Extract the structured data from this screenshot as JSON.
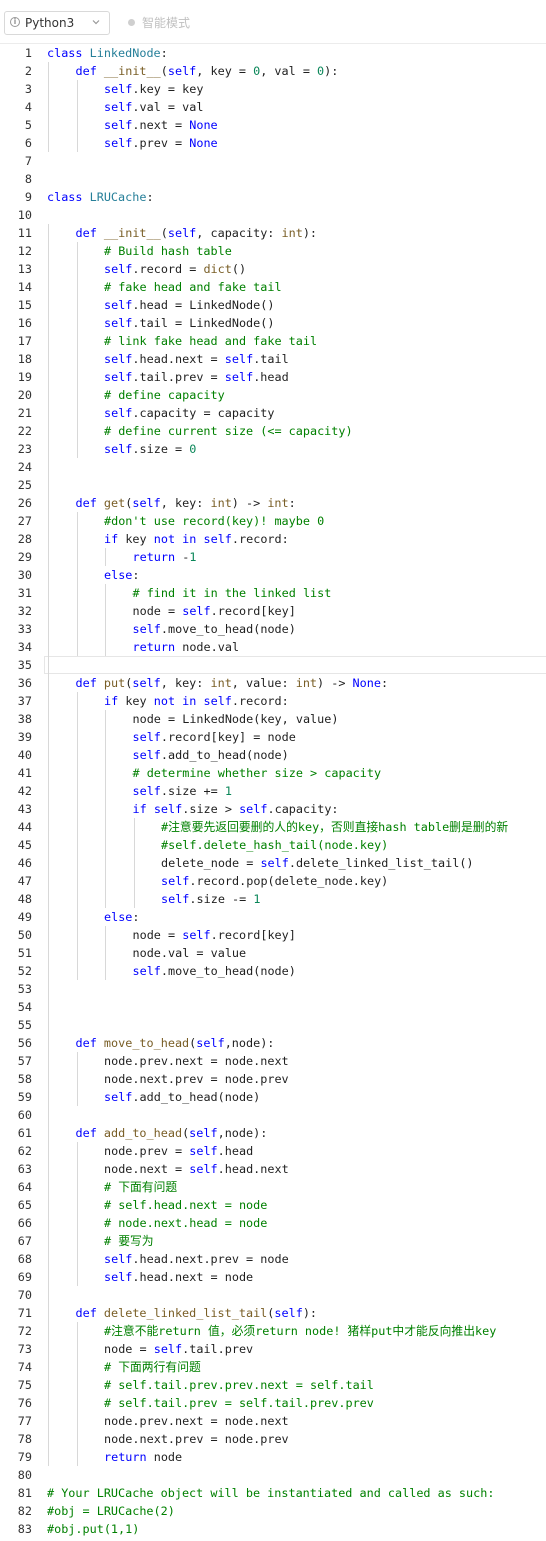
{
  "toolbar": {
    "language": "Python3",
    "language_icon": "info-icon",
    "dropdown_icon": "chevron-down-icon",
    "mode_label": "智能模式"
  },
  "editor": {
    "active_line": 35,
    "lines": [
      {
        "n": "1",
        "i": 0,
        "t": "class LinkedNode:"
      },
      {
        "n": "2",
        "i": 1,
        "t": "def __init__(self, key = 0, val = 0):"
      },
      {
        "n": "3",
        "i": 2,
        "t": "self.key = key"
      },
      {
        "n": "4",
        "i": 2,
        "t": "self.val = val"
      },
      {
        "n": "5",
        "i": 2,
        "t": "self.next = None"
      },
      {
        "n": "6",
        "i": 2,
        "t": "self.prev = None"
      },
      {
        "n": "7",
        "i": 0,
        "t": ""
      },
      {
        "n": "8",
        "i": 0,
        "t": ""
      },
      {
        "n": "9",
        "i": 0,
        "t": "class LRUCache:"
      },
      {
        "n": "10",
        "i": 0,
        "t": ""
      },
      {
        "n": "11",
        "i": 1,
        "t": "def __init__(self, capacity: int):"
      },
      {
        "n": "12",
        "i": 2,
        "t": "# Build hash table"
      },
      {
        "n": "13",
        "i": 2,
        "t": "self.record = dict()"
      },
      {
        "n": "14",
        "i": 2,
        "t": "# fake head and fake tail"
      },
      {
        "n": "15",
        "i": 2,
        "t": "self.head = LinkedNode()"
      },
      {
        "n": "16",
        "i": 2,
        "t": "self.tail = LinkedNode()"
      },
      {
        "n": "17",
        "i": 2,
        "t": "# link fake head and fake tail"
      },
      {
        "n": "18",
        "i": 2,
        "t": "self.head.next = self.tail"
      },
      {
        "n": "19",
        "i": 2,
        "t": "self.tail.prev = self.head"
      },
      {
        "n": "20",
        "i": 2,
        "t": "# define capacity"
      },
      {
        "n": "21",
        "i": 2,
        "t": "self.capacity = capacity"
      },
      {
        "n": "22",
        "i": 2,
        "t": "# define current size (<= capacity)"
      },
      {
        "n": "23",
        "i": 2,
        "t": "self.size = 0"
      },
      {
        "n": "24",
        "i": 0,
        "t": ""
      },
      {
        "n": "25",
        "i": 0,
        "t": ""
      },
      {
        "n": "26",
        "i": 1,
        "t": "def get(self, key: int) -> int:"
      },
      {
        "n": "27",
        "i": 2,
        "t": "#don't use record(key)! maybe 0"
      },
      {
        "n": "28",
        "i": 2,
        "t": "if key not in self.record:"
      },
      {
        "n": "29",
        "i": 3,
        "t": "return -1"
      },
      {
        "n": "30",
        "i": 2,
        "t": "else:"
      },
      {
        "n": "31",
        "i": 3,
        "t": "# find it in the linked list"
      },
      {
        "n": "32",
        "i": 3,
        "t": "node = self.record[key]"
      },
      {
        "n": "33",
        "i": 3,
        "t": "self.move_to_head(node)"
      },
      {
        "n": "34",
        "i": 3,
        "t": "return node.val"
      },
      {
        "n": "35",
        "i": 0,
        "t": ""
      },
      {
        "n": "36",
        "i": 1,
        "t": "def put(self, key: int, value: int) -> None:"
      },
      {
        "n": "37",
        "i": 2,
        "t": "if key not in self.record:"
      },
      {
        "n": "38",
        "i": 3,
        "t": "node = LinkedNode(key, value)"
      },
      {
        "n": "39",
        "i": 3,
        "t": "self.record[key] = node"
      },
      {
        "n": "40",
        "i": 3,
        "t": "self.add_to_head(node)"
      },
      {
        "n": "41",
        "i": 3,
        "t": "# determine whether size > capacity"
      },
      {
        "n": "42",
        "i": 3,
        "t": "self.size += 1"
      },
      {
        "n": "43",
        "i": 3,
        "t": "if self.size > self.capacity:"
      },
      {
        "n": "44",
        "i": 4,
        "t": "#注意要先返回要删的人的key，否则直接hash table删是删的新"
      },
      {
        "n": "45",
        "i": 4,
        "t": "#self.delete_hash_tail(node.key)"
      },
      {
        "n": "46",
        "i": 4,
        "t": "delete_node = self.delete_linked_list_tail()"
      },
      {
        "n": "47",
        "i": 4,
        "t": "self.record.pop(delete_node.key)"
      },
      {
        "n": "48",
        "i": 4,
        "t": "self.size -= 1"
      },
      {
        "n": "49",
        "i": 2,
        "t": "else:"
      },
      {
        "n": "50",
        "i": 3,
        "t": "node = self.record[key]"
      },
      {
        "n": "51",
        "i": 3,
        "t": "node.val = value"
      },
      {
        "n": "52",
        "i": 3,
        "t": "self.move_to_head(node)"
      },
      {
        "n": "53",
        "i": 0,
        "t": ""
      },
      {
        "n": "54",
        "i": 0,
        "t": ""
      },
      {
        "n": "55",
        "i": 0,
        "t": ""
      },
      {
        "n": "56",
        "i": 1,
        "t": "def move_to_head(self,node):"
      },
      {
        "n": "57",
        "i": 2,
        "t": "node.prev.next = node.next"
      },
      {
        "n": "58",
        "i": 2,
        "t": "node.next.prev = node.prev"
      },
      {
        "n": "59",
        "i": 2,
        "t": "self.add_to_head(node)"
      },
      {
        "n": "60",
        "i": 0,
        "t": ""
      },
      {
        "n": "61",
        "i": 1,
        "t": "def add_to_head(self,node):"
      },
      {
        "n": "62",
        "i": 2,
        "t": "node.prev = self.head"
      },
      {
        "n": "63",
        "i": 2,
        "t": "node.next = self.head.next"
      },
      {
        "n": "64",
        "i": 2,
        "t": "# 下面有问题"
      },
      {
        "n": "65",
        "i": 2,
        "t": "# self.head.next = node"
      },
      {
        "n": "66",
        "i": 2,
        "t": "# node.next.head = node"
      },
      {
        "n": "67",
        "i": 2,
        "t": "# 要写为"
      },
      {
        "n": "68",
        "i": 2,
        "t": "self.head.next.prev = node"
      },
      {
        "n": "69",
        "i": 2,
        "t": "self.head.next = node"
      },
      {
        "n": "70",
        "i": 0,
        "t": ""
      },
      {
        "n": "71",
        "i": 1,
        "t": "def delete_linked_list_tail(self):"
      },
      {
        "n": "72",
        "i": 2,
        "t": "#注意不能return 值，必须return node! 猪样put中才能反向推出key"
      },
      {
        "n": "73",
        "i": 2,
        "t": "node = self.tail.prev"
      },
      {
        "n": "74",
        "i": 2,
        "t": "# 下面两行有问题"
      },
      {
        "n": "75",
        "i": 2,
        "t": "# self.tail.prev.prev.next = self.tail"
      },
      {
        "n": "76",
        "i": 2,
        "t": "# self.tail.prev = self.tail.prev.prev"
      },
      {
        "n": "77",
        "i": 2,
        "t": "node.prev.next = node.next"
      },
      {
        "n": "78",
        "i": 2,
        "t": "node.next.prev = node.prev"
      },
      {
        "n": "79",
        "i": 2,
        "t": "return node"
      },
      {
        "n": "80",
        "i": 0,
        "t": ""
      },
      {
        "n": "81",
        "i": 0,
        "t": "# Your LRUCache object will be instantiated and called as such:"
      },
      {
        "n": "82",
        "i": 0,
        "t": "#obj = LRUCache(2)"
      },
      {
        "n": "83",
        "i": 0,
        "t": "#obj.put(1,1)"
      }
    ]
  }
}
